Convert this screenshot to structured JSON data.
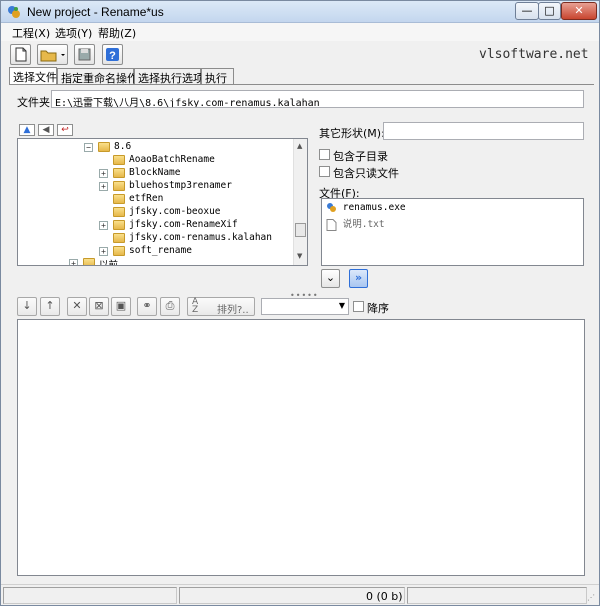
{
  "window": {
    "title": "New project - Rename*us",
    "min_label": "—",
    "max_label": "□",
    "close_label": "✕"
  },
  "menu": {
    "items": [
      {
        "label": "工程(X)"
      },
      {
        "label": "选项(Y)"
      },
      {
        "label": "帮助(Z)"
      }
    ]
  },
  "toolbar": {
    "brand": "vlsoftware.net"
  },
  "tabs": [
    {
      "label": "选择文件",
      "active": true
    },
    {
      "label": "指定重命名操作",
      "active": false
    },
    {
      "label": "选择执行选项",
      "active": false
    },
    {
      "label": "执行",
      "active": false
    }
  ],
  "folder": {
    "label": "文件夹:",
    "value": "E:\\迅雷下载\\八月\\8.6\\jfsky.com-renamus.kalahan"
  },
  "tree": {
    "items": [
      {
        "label": "8.6",
        "expander": "−"
      },
      {
        "label": "AoaoBatchRename",
        "expander": ""
      },
      {
        "label": "BlockName",
        "expander": "+"
      },
      {
        "label": "bluehostmp3renamer",
        "expander": "+"
      },
      {
        "label": "etfRen",
        "expander": ""
      },
      {
        "label": "jfsky.com-beoxue",
        "expander": ""
      },
      {
        "label": "jfsky.com-RenameXif",
        "expander": "+"
      },
      {
        "label": "jfsky.com-renamus.kalahan",
        "expander": ""
      },
      {
        "label": "soft_rename",
        "expander": "+"
      },
      {
        "label": "以前",
        "expander": "+"
      }
    ]
  },
  "options": {
    "other_shapes_label": "其它形状(M):",
    "other_shapes_value": "",
    "include_subdirs_label": "包含子目录",
    "include_readonly_label": "包含只读文件",
    "files_label": "文件(F):"
  },
  "files": [
    {
      "name": "renamus.exe"
    },
    {
      "name": "说明.txt"
    }
  ],
  "file_toolbar": {
    "sort_label": "排列?..",
    "descending_label": "降序"
  },
  "status": {
    "count": "0 (0 b)"
  },
  "colors": {
    "accent": "#2f6fd8",
    "folder": "#e6b84a",
    "close": "#c8452f"
  }
}
